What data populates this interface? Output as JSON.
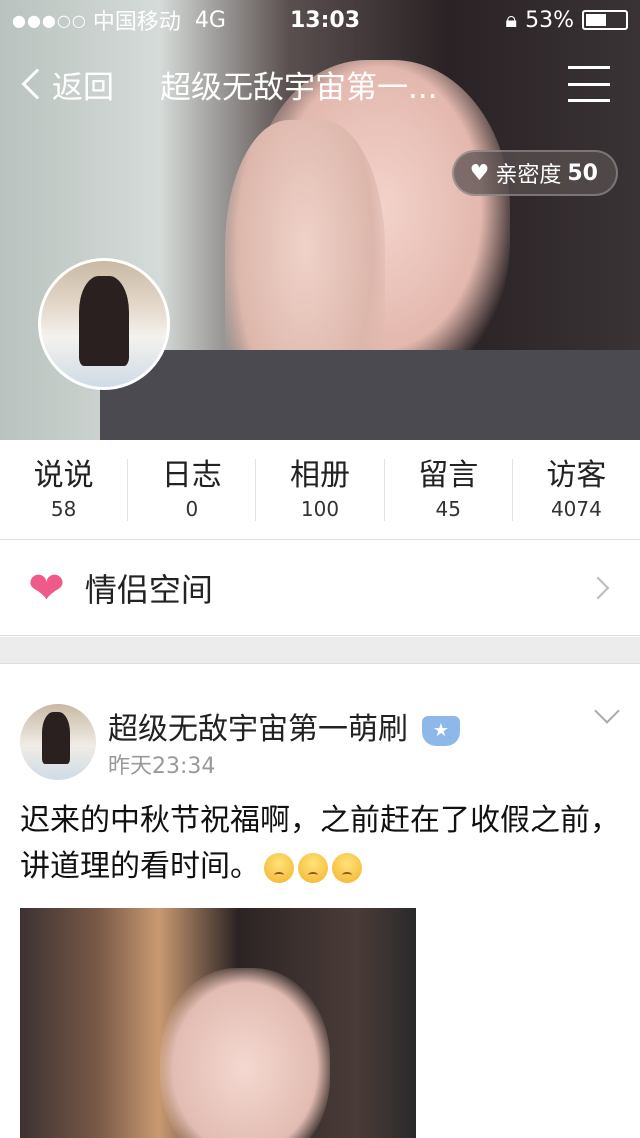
{
  "status": {
    "signal": "●●●○○",
    "carrier": "中国移动",
    "network": "4G",
    "time": "13:03",
    "battery": "53%",
    "battery_level": 0.53
  },
  "nav": {
    "back": "返回",
    "title": "超级无敌宇宙第一..."
  },
  "intimacy": {
    "label": "亲密度",
    "value": "50"
  },
  "stats": [
    {
      "label": "说说",
      "count": "58"
    },
    {
      "label": "日志",
      "count": "0"
    },
    {
      "label": "相册",
      "count": "100"
    },
    {
      "label": "留言",
      "count": "45"
    },
    {
      "label": "访客",
      "count": "4074"
    }
  ],
  "couple": {
    "label": "情侣空间"
  },
  "post": {
    "name": "超级无敌宇宙第一萌刷",
    "time": "昨天23:34",
    "text": "迟来的中秋节祝福啊，之前赶在了收假之前，讲道理的看时间。",
    "emoji_count": 3
  }
}
